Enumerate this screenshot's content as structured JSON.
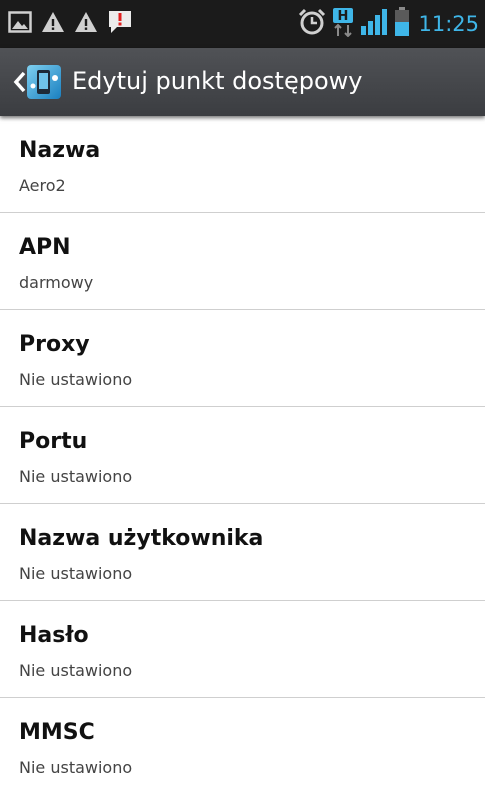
{
  "status_bar": {
    "time": "11:25",
    "time_color": "#3fb6e8",
    "icons": [
      "image-icon",
      "warning-icon",
      "warning-icon",
      "message-alert-icon",
      "alarm-clock-icon",
      "hspa-data-icon",
      "signal-strength-icon",
      "battery-icon"
    ]
  },
  "action_bar": {
    "title": "Edytuj punkt dostępowy",
    "back_icon": "chevron-left-icon",
    "app_icon": "phone-settings-icon"
  },
  "settings": {
    "items": [
      {
        "title": "Nazwa",
        "value": "Aero2"
      },
      {
        "title": "APN",
        "value": "darmowy"
      },
      {
        "title": "Proxy",
        "value": "Nie ustawiono"
      },
      {
        "title": "Portu",
        "value": "Nie ustawiono"
      },
      {
        "title": "Nazwa użytkownika",
        "value": "Nie ustawiono"
      },
      {
        "title": "Hasło",
        "value": "Nie ustawiono"
      },
      {
        "title": "MMSC",
        "value": "Nie ustawiono"
      }
    ]
  }
}
